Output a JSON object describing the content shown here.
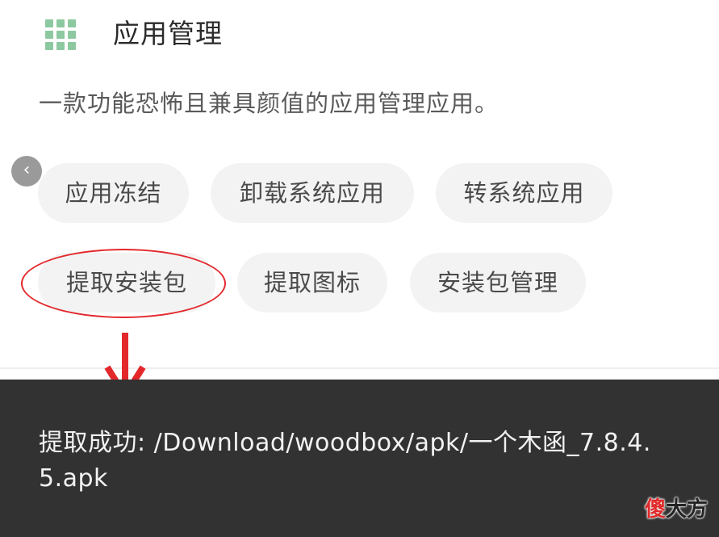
{
  "header": {
    "icon": "apps-grid-icon",
    "title": "应用管理"
  },
  "description": "一款功能恐怖且兼具颜值的应用管理应用。",
  "back_icon_glyph": "‹",
  "chips": [
    "应用冻结",
    "卸载系统应用",
    "转系统应用",
    "提取安装包",
    "提取图标",
    "安装包管理"
  ],
  "toast": {
    "text": "提取成功: /Download/woodbox/apk/一个木函_7.8.4.5.apk"
  },
  "watermark": {
    "part1": "傻",
    "part2": "大方"
  },
  "colors": {
    "accent_icon": "#8cc9a0",
    "annotation_red": "#e3282c",
    "toast_bg": "#323232",
    "chip_bg": "#f3f3f3"
  }
}
